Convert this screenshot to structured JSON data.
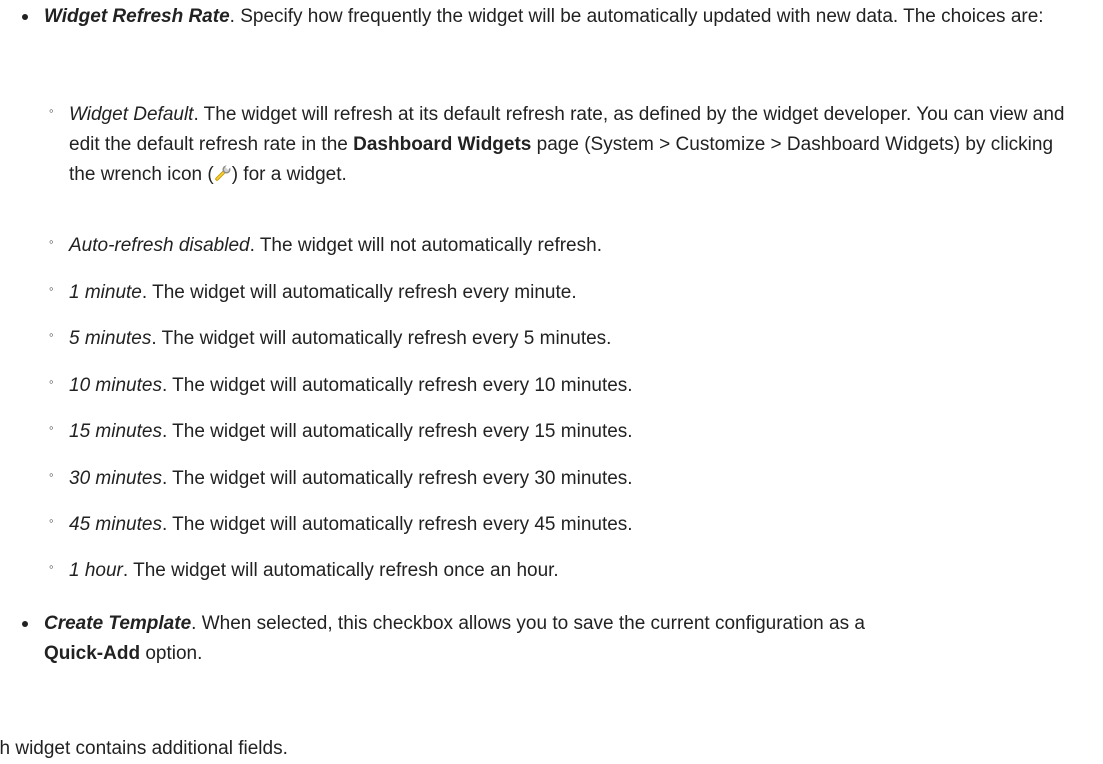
{
  "refresh": {
    "term": "Widget Refresh Rate",
    "desc": ". Specify how frequently the widget will be automatically updated with new data. The choices are:"
  },
  "options": [
    {
      "term": "Widget Default",
      "desc_a": ". The widget will refresh at its default refresh rate, as defined by the widget developer. You can view and edit the default refresh rate in the ",
      "link": "Dashboard Widgets",
      "desc_b": " page (System > Customize > Dashboard Widgets) by clicking the wrench icon (",
      "desc_c": ") for a widget."
    },
    {
      "term": "Auto-refresh disabled",
      "desc": ". The widget will not automatically refresh."
    },
    {
      "term": "1 minute",
      "desc": ". The widget will automatically refresh every minute."
    },
    {
      "term": "5 minutes",
      "desc": ". The widget will automatically refresh every 5 minutes."
    },
    {
      "term": "10 minutes",
      "desc": ". The widget will automatically refresh every 10 minutes."
    },
    {
      "term": "15 minutes",
      "desc": ". The widget will automatically refresh every 15 minutes."
    },
    {
      "term": "30 minutes",
      "desc": ". The widget will automatically refresh every 30 minutes."
    },
    {
      "term": "45 minutes",
      "desc": ". The widget will automatically refresh every 45 minutes."
    },
    {
      "term": "1 hour",
      "desc": ". The widget will automatically refresh once an hour."
    }
  ],
  "template": {
    "term": "Create Template",
    "desc": ". When selected, this checkbox allows you to save the current configuration as a ",
    "bold": "Quick-Add",
    "tail": " option."
  },
  "footer": "ch widget contains additional fields.",
  "icons": {
    "wrench": "wrench-icon"
  },
  "marker": "◦"
}
